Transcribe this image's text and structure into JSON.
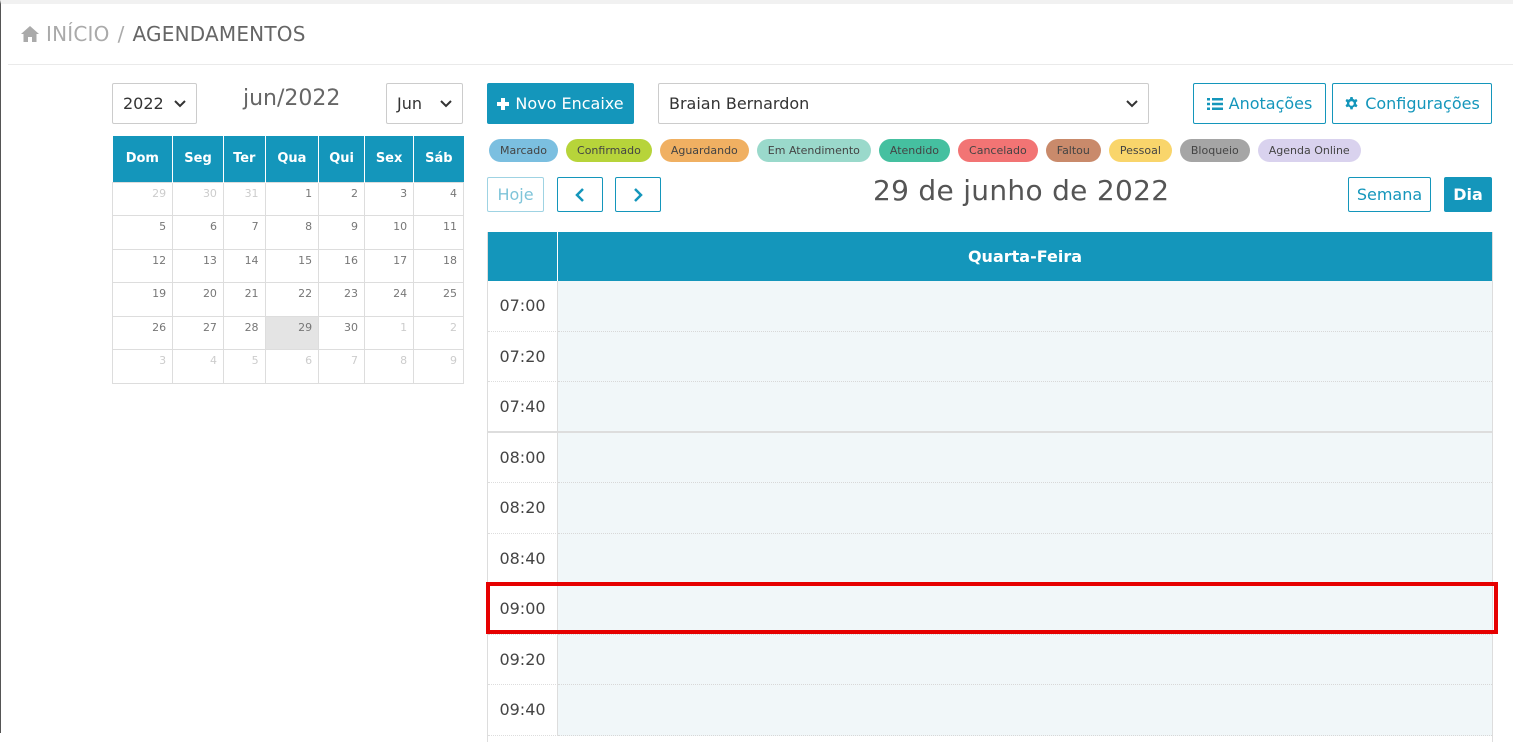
{
  "breadcrumb": {
    "home": "INÍCIO",
    "separator": "/",
    "current": "AGENDAMENTOS"
  },
  "mini_calendar": {
    "year_select": "2022",
    "month_title": "jun/2022",
    "month_select": "Jun",
    "weekdays": [
      "Dom",
      "Seg",
      "Ter",
      "Qua",
      "Qui",
      "Sex",
      "Sáb"
    ],
    "weeks": [
      [
        "29",
        "30",
        "31",
        "1",
        "2",
        "3",
        "4"
      ],
      [
        "5",
        "6",
        "7",
        "8",
        "9",
        "10",
        "11"
      ],
      [
        "12",
        "13",
        "14",
        "15",
        "16",
        "17",
        "18"
      ],
      [
        "19",
        "20",
        "21",
        "22",
        "23",
        "24",
        "25"
      ],
      [
        "26",
        "27",
        "28",
        "29",
        "30",
        "1",
        "2"
      ],
      [
        "3",
        "4",
        "5",
        "6",
        "7",
        "8",
        "9"
      ]
    ],
    "selected_day": "29"
  },
  "toolbar": {
    "new_button": "Novo Encaixe",
    "professional_select": "Braian Bernardon",
    "notes_button": "Anotações",
    "settings_button": "Configurações"
  },
  "legend": [
    {
      "label": "Marcado",
      "color": "#7bbfe0"
    },
    {
      "label": "Confirmado",
      "color": "#b7d43a"
    },
    {
      "label": "Aguardando",
      "color": "#f0b062"
    },
    {
      "label": "Em Atendimento",
      "color": "#9ad9cb"
    },
    {
      "label": "Atendido",
      "color": "#45c0a0"
    },
    {
      "label": "Cancelado",
      "color": "#f27474"
    },
    {
      "label": "Faltou",
      "color": "#c98a6b"
    },
    {
      "label": "Pessoal",
      "color": "#f9d56b"
    },
    {
      "label": "Bloqueio",
      "color": "#a5a5a5"
    },
    {
      "label": "Agenda Online",
      "color": "#d9d2ee"
    }
  ],
  "nav": {
    "today": "Hoje",
    "date_title": "29 de junho de 2022",
    "week_view": "Semana",
    "day_view": "Dia"
  },
  "day_grid": {
    "day_header": "Quarta-Feira",
    "slots": [
      "07:00",
      "07:20",
      "07:40",
      "08:00",
      "08:20",
      "08:40",
      "09:00",
      "09:20",
      "09:40"
    ],
    "highlighted_slot": "09:00"
  },
  "colors": {
    "accent": "#1496bb",
    "highlight": "#e60000",
    "slot_bg": "#f1f7f9"
  }
}
